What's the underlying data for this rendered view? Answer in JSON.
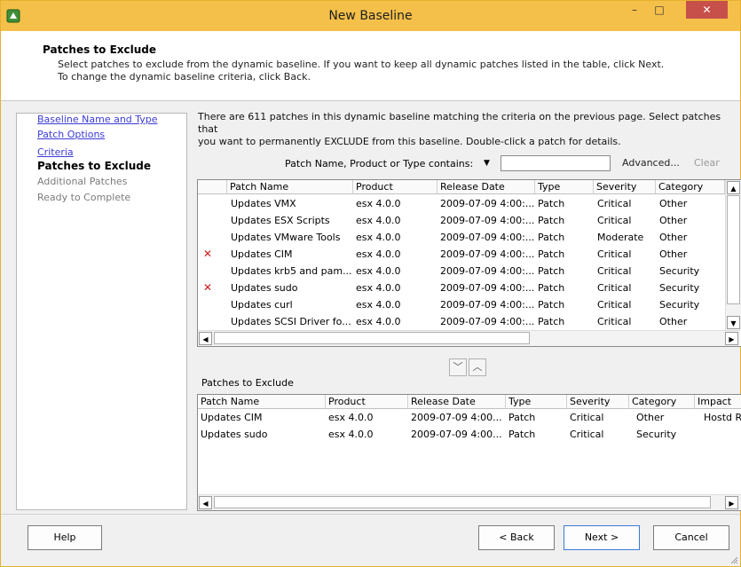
{
  "window": {
    "title": "New Baseline",
    "minimize": "–",
    "maximize": "□",
    "close": "✕"
  },
  "header": {
    "title": "Patches to Exclude",
    "desc_line1": "Select patches to exclude from the dynamic baseline. If you want to keep all dynamic patches listed in the table, click Next.",
    "desc_line2": "To change the dynamic baseline criteria, click Back."
  },
  "nav": {
    "items": [
      {
        "label": "Baseline Name and Type",
        "state": "link"
      },
      {
        "label": "Patch Options",
        "state": "link"
      },
      {
        "label": "Criteria",
        "state": "link"
      },
      {
        "label": "Patches to Exclude",
        "state": "current"
      },
      {
        "label": "Additional Patches",
        "state": "disabled"
      },
      {
        "label": "Ready to Complete",
        "state": "disabled"
      }
    ]
  },
  "main": {
    "intro_line1": "There are 611 patches in this dynamic baseline matching the criteria on the previous page. Select patches that",
    "intro_line2": "you want to permanently EXCLUDE from this baseline. Double-click a patch for details.",
    "filter_label": "Patch Name, Product or Type contains:",
    "filter_value": "",
    "advanced": "Advanced...",
    "clear": "Clear"
  },
  "patches_table": {
    "columns": [
      "Patch Name",
      "Product",
      "Release Date",
      "Type",
      "Severity",
      "Category"
    ],
    "rows": [
      {
        "excluded": false,
        "cells": [
          "Updates VMX",
          "esx 4.0.0",
          "2009-07-09 4:00:...",
          "Patch",
          "Critical",
          "Other"
        ]
      },
      {
        "excluded": false,
        "cells": [
          "Updates ESX Scripts",
          "esx 4.0.0",
          "2009-07-09 4:00:...",
          "Patch",
          "Critical",
          "Other"
        ]
      },
      {
        "excluded": false,
        "cells": [
          "Updates VMware Tools",
          "esx 4.0.0",
          "2009-07-09 4:00:...",
          "Patch",
          "Moderate",
          "Other"
        ]
      },
      {
        "excluded": true,
        "cells": [
          "Updates CIM",
          "esx 4.0.0",
          "2009-07-09 4:00:...",
          "Patch",
          "Critical",
          "Other"
        ]
      },
      {
        "excluded": false,
        "cells": [
          "Updates krb5 and pam...",
          "esx 4.0.0",
          "2009-07-09 4:00:...",
          "Patch",
          "Critical",
          "Security"
        ]
      },
      {
        "excluded": true,
        "cells": [
          "Updates sudo",
          "esx 4.0.0",
          "2009-07-09 4:00:...",
          "Patch",
          "Critical",
          "Security"
        ]
      },
      {
        "excluded": false,
        "cells": [
          "Updates curl",
          "esx 4.0.0",
          "2009-07-09 4:00:...",
          "Patch",
          "Critical",
          "Security"
        ]
      },
      {
        "excluded": false,
        "cells": [
          "Updates SCSI Driver fo...",
          "esx 4.0.0",
          "2009-07-09 4:00:...",
          "Patch",
          "Critical",
          "Other"
        ]
      }
    ],
    "exclude_mark": "✕"
  },
  "move_buttons": {
    "down": "﹀",
    "up": "︿"
  },
  "excluded_table": {
    "label": "Patches to Exclude",
    "columns": [
      "Patch Name",
      "Product",
      "Release Date",
      "Type",
      "Severity",
      "Category",
      "Impact"
    ],
    "rows": [
      [
        "Updates CIM",
        "esx 4.0.0",
        "2009-07-09 4:00...",
        "Patch",
        "Critical",
        "Other",
        "Hostd R"
      ],
      [
        "Updates sudo",
        "esx 4.0.0",
        "2009-07-09 4:00...",
        "Patch",
        "Critical",
        "Security",
        ""
      ]
    ]
  },
  "footer": {
    "help": "Help",
    "back": "< Back",
    "next": "Next >",
    "cancel": "Cancel"
  },
  "scroll": {
    "up": "▲",
    "down": "▼",
    "left": "◀",
    "right": "▶"
  }
}
